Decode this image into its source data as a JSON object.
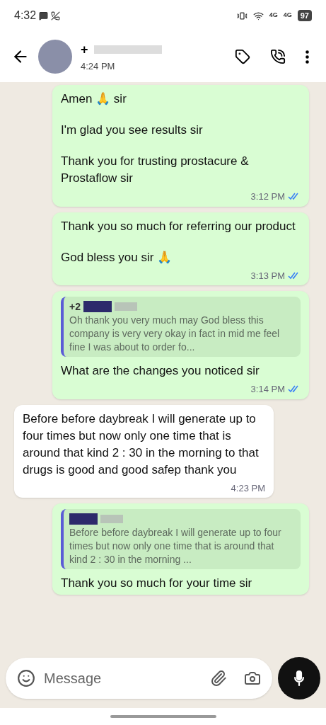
{
  "status_bar": {
    "time": "4:32",
    "battery": "97",
    "network_1": "4G",
    "network_2": "4G"
  },
  "header": {
    "contact_name": "+",
    "last_seen": "4:24 PM"
  },
  "messages": [
    {
      "kind": "outgoing",
      "paragraphs": [
        "Amen 🙏 sir",
        "I'm glad you see results sir",
        "Thank you for trusting prostacure & Prostaflow sir"
      ],
      "time": "3:12 PM",
      "read": true
    },
    {
      "kind": "outgoing",
      "paragraphs": [
        "Thank you so much for referring our product",
        "God bless you sir 🙏"
      ],
      "time": "3:13 PM",
      "read": true
    },
    {
      "kind": "outgoing",
      "quote": {
        "sender": "+2",
        "text": "Oh thank you very much may God bless this company is very very okay in fact in mid me feel fine I was about to order fo..."
      },
      "paragraphs": [
        "What are the changes you noticed sir"
      ],
      "time": "3:14 PM",
      "read": true
    },
    {
      "kind": "incoming",
      "paragraphs": [
        "Before before daybreak I will generate up to four times but now only one time that is around that kind 2 : 30 in the morning to that drugs is good and good safep thank you"
      ],
      "time": "4:23 PM"
    },
    {
      "kind": "outgoing",
      "quote": {
        "text": "Before before daybreak I will generate up to four times but now only one time that is around that kind 2 : 30 in the morning ..."
      },
      "paragraphs": [
        "Thank you so much for your time sir"
      ]
    }
  ],
  "composer": {
    "placeholder": "Message"
  }
}
